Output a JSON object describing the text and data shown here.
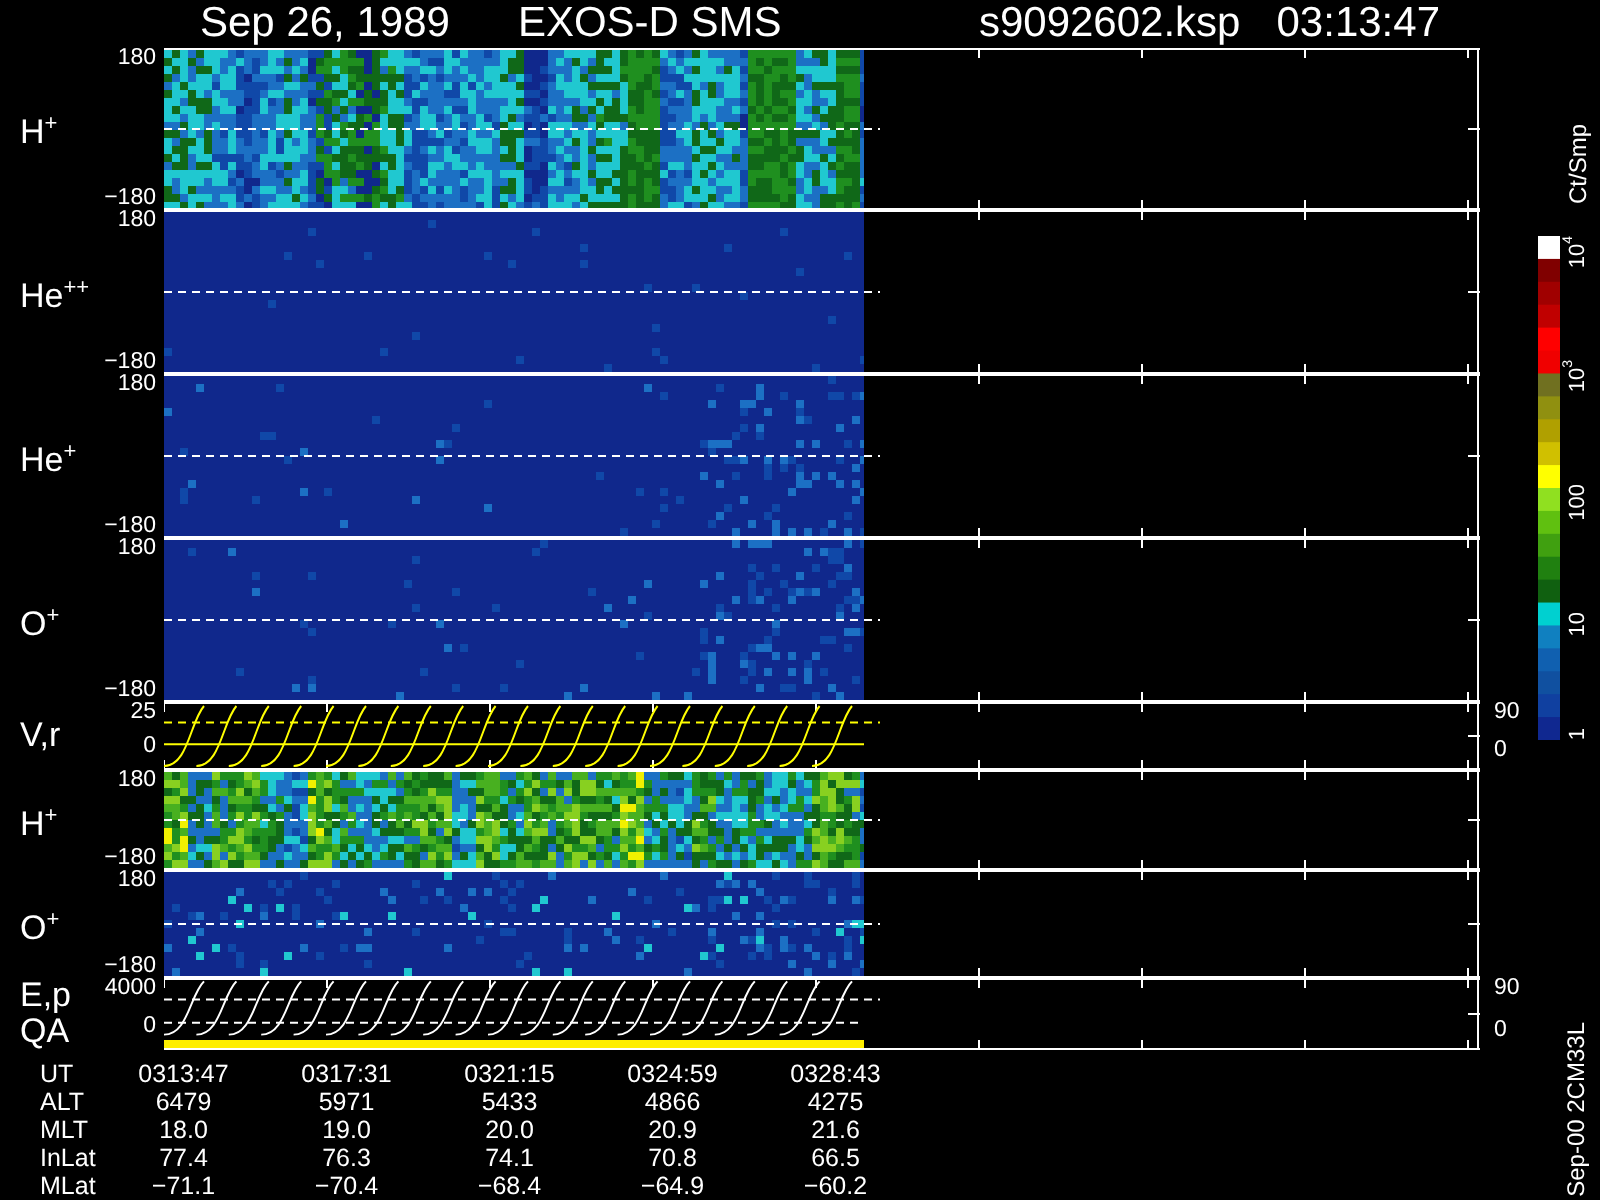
{
  "header": {
    "date": "Sep 26, 1989",
    "instrument": "EXOS-D SMS",
    "file": "s9092602.ksp",
    "time": "03:13:47"
  },
  "panels": [
    {
      "kind": "spectrogram",
      "label": "H$^{+}$",
      "ticks": [
        "180",
        "−180"
      ]
    },
    {
      "kind": "spectrogram",
      "label": "He$^{++}$",
      "ticks": [
        "180",
        "−180"
      ]
    },
    {
      "kind": "spectrogram",
      "label": "He$^{+}$",
      "ticks": [
        "180",
        "−180"
      ]
    },
    {
      "kind": "spectrogram",
      "label": "O$^{+}$",
      "ticks": [
        "180",
        "−180"
      ]
    },
    {
      "kind": "trace",
      "label": "V,r",
      "ticks": [
        "25",
        "0"
      ],
      "right_ticks": [
        "90",
        "0"
      ],
      "color": "#ffff00"
    },
    {
      "kind": "spectrogram",
      "label": "H$^{+}$",
      "ticks": [
        "180",
        "−180"
      ]
    },
    {
      "kind": "spectrogram",
      "label": "O$^{+}$",
      "ticks": [
        "180",
        "−180"
      ]
    },
    {
      "kind": "trace",
      "label": "E,p",
      "sublabel": "QA",
      "ticks": [
        "4000",
        "0"
      ],
      "right_ticks": [
        "90",
        "0"
      ],
      "color": "#ffffff",
      "qa_bar": true
    }
  ],
  "table": {
    "rows": [
      {
        "label": "UT",
        "values": [
          "0313:47",
          "0317:31",
          "0321:15",
          "0324:59",
          "0328:43"
        ]
      },
      {
        "label": "ALT",
        "values": [
          "6479",
          "5971",
          "5433",
          "4866",
          "4275"
        ]
      },
      {
        "label": "MLT",
        "values": [
          "18.0",
          "19.0",
          "20.0",
          "20.9",
          "21.6"
        ]
      },
      {
        "label": "InLat",
        "values": [
          "77.4",
          "76.3",
          "74.1",
          "70.8",
          "66.5"
        ]
      },
      {
        "label": "MLat",
        "values": [
          "−71.1",
          "−70.4",
          "−68.4",
          "−64.9",
          "−60.2"
        ]
      }
    ]
  },
  "color_scale": {
    "unit": "Ct/Smp",
    "labels": [
      "10$^{4}$",
      "10$^{3}$",
      "100",
      "10",
      "1"
    ]
  },
  "footer": "Sep-00 2CM33L"
}
